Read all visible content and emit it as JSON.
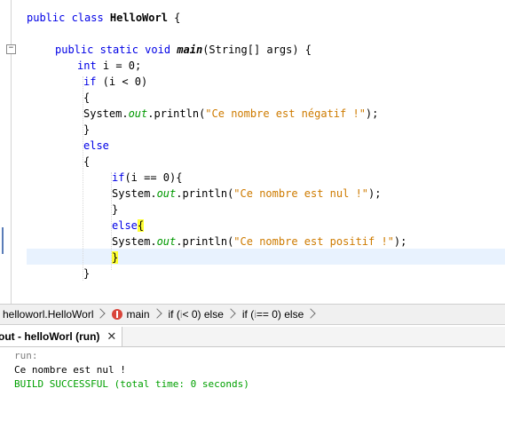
{
  "editor": {
    "lines": [
      {
        "a": "public class ",
        "b": "HelloWorl",
        "c": " {"
      },
      {
        "a": "public static void ",
        "b": "main",
        "c": "(String[] args) {"
      },
      {
        "a": "int",
        "b": " i = 0;"
      },
      {
        "a": "if",
        "b": " (i < 0)"
      },
      {
        "a": "{"
      },
      {
        "a": "System.",
        "b": "out",
        "c": ".println(",
        "d": "\"Ce nombre est négatif !\"",
        "e": ");"
      },
      {
        "a": "}"
      },
      {
        "a": "else"
      },
      {
        "a": "{"
      },
      {
        "a": "if",
        "b": "(i == 0){"
      },
      {
        "a": "System.",
        "b": "out",
        "c": ".println(",
        "d": "\"Ce nombre est nul !\"",
        "e": ");"
      },
      {
        "a": "}"
      },
      {
        "a": "else",
        "b": "{"
      },
      {
        "a": "System.",
        "b": "out",
        "c": ".println(",
        "d": "\"Ce nombre est positif !\"",
        "e": ");"
      },
      {
        "a": "}"
      },
      {
        "a": "}"
      }
    ],
    "fold_marker": "−"
  },
  "breadcrumb": {
    "items": [
      {
        "label": "helloworl.HelloWorl"
      },
      {
        "label": "main"
      },
      {
        "pre": "if (",
        "var": "i",
        "post": " < 0) else"
      },
      {
        "pre": "if (",
        "var": "i",
        "post": " == 0) else"
      }
    ]
  },
  "output": {
    "tab_label": "out - helloWorl (run)",
    "close_label": "✕",
    "lines": [
      "run:",
      "Ce nombre est nul !",
      "BUILD SUCCESSFUL (total time: 0 seconds)"
    ]
  },
  "colors": {
    "keyword": "#0000e6",
    "string": "#ce7b00",
    "field": "#009900",
    "current_line": "#e8f2fe",
    "brace_highlight": "#ffff33",
    "build_success": "#00a000"
  },
  "icons": {
    "fold": "fold-collapse-icon",
    "method": "method-icon",
    "separator": "chevron-right-icon",
    "close": "close-icon"
  }
}
